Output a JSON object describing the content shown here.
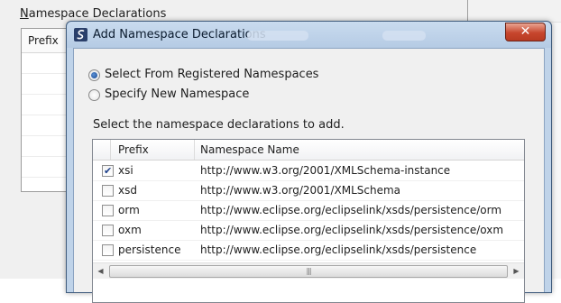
{
  "parent_window": {
    "section_title_mnemonic": "N",
    "section_title_rest": "amespace Declarations",
    "table_header": "Prefix"
  },
  "dialog": {
    "title": "Add Namespace Declarations",
    "close_symbol": "✕",
    "options": [
      {
        "label": "Select From Registered Namespaces",
        "selected": true
      },
      {
        "label": "Specify New Namespace",
        "selected": false
      }
    ],
    "instruction": "Select the namespace declarations to add.",
    "table": {
      "columns": [
        "Prefix",
        "Namespace Name"
      ],
      "rows": [
        {
          "checked": true,
          "prefix": "xsi",
          "namespace": "http://www.w3.org/2001/XMLSchema-instance"
        },
        {
          "checked": false,
          "prefix": "xsd",
          "namespace": "http://www.w3.org/2001/XMLSchema"
        },
        {
          "checked": false,
          "prefix": "orm",
          "namespace": "http://www.eclipse.org/eclipselink/xsds/persistence/orm"
        },
        {
          "checked": false,
          "prefix": "oxm",
          "namespace": "http://www.eclipse.org/eclipselink/xsds/persistence/oxm"
        },
        {
          "checked": false,
          "prefix": "persistence",
          "namespace": "http://www.eclipse.org/eclipselink/xsds/persistence"
        }
      ],
      "scroll_left_icon": "◀",
      "scroll_right_icon": "▶",
      "scroll_thumb_grip": "|||"
    }
  }
}
